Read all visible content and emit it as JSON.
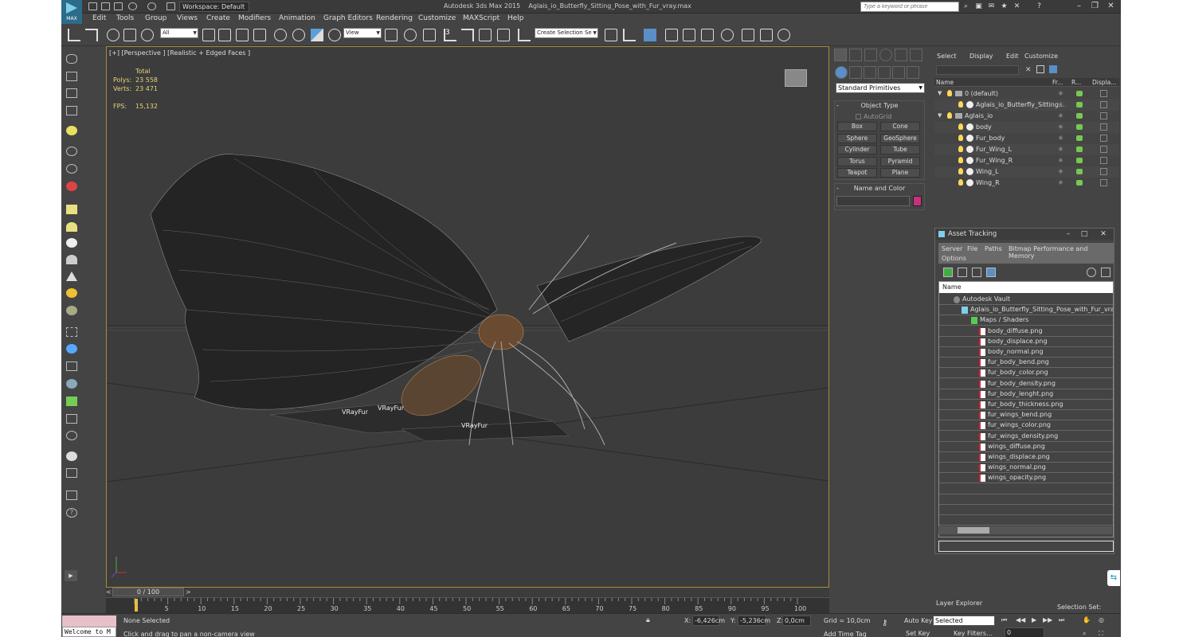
{
  "titlebar": {
    "workspace": "Workspace: Default",
    "app_title": "Autodesk 3ds Max 2015",
    "file_title": "Aglais_io_Butterfly_Sitting_Pose_with_Fur_vray.max",
    "search_placeholder": "Type a keyword or phrase",
    "logo_text": "MAX"
  },
  "menu": [
    "Edit",
    "Tools",
    "Group",
    "Views",
    "Create",
    "Modifiers",
    "Animation",
    "Graph Editors",
    "Rendering",
    "Customize",
    "MAXScript",
    "Help"
  ],
  "toolbar": {
    "filter": "All",
    "refcoord": "View",
    "selection_set": "Create Selection Se",
    "snap_label": "3"
  },
  "viewport": {
    "label": "[+] [Perspective ] [Realistic + Edged Faces ]",
    "stats_total": "Total",
    "polys_label": "Polys:",
    "polys_value": "23 558",
    "verts_label": "Verts:",
    "verts_value": "23 471",
    "fps_label": "FPS:",
    "fps_value": "15,132",
    "fur_labels": [
      "VRayFur",
      "VRayFur",
      "VRayFur"
    ]
  },
  "timeline": {
    "frame": "0 / 100",
    "ticks": [
      "5",
      "10",
      "15",
      "20",
      "25",
      "30",
      "35",
      "40",
      "45",
      "50",
      "55",
      "60",
      "65",
      "70",
      "75",
      "80",
      "85",
      "90",
      "95",
      "100"
    ]
  },
  "status": {
    "maxscript": "Welcome to M",
    "selection": "None Selected",
    "prompt": "Click and drag to pan a non-camera view",
    "x_label": "X:",
    "x_value": "-6,426cm",
    "y_label": "Y:",
    "y_value": "-5,236cm",
    "z_label": "Z:",
    "z_value": "0,0cm",
    "grid": "Grid = 10,0cm",
    "add_time_tag": "Add Time Tag",
    "auto_key": "Auto Key",
    "set_key": "Set Key",
    "key_mode": "Selected",
    "key_filters": "Key Filters...",
    "current_frame": "0",
    "selection_set": "Selection Set:"
  },
  "command_panel": {
    "category": "Standard Primitives",
    "object_type_title": "Object Type",
    "autogrid": "AutoGrid",
    "primitives": [
      "Box",
      "Cone",
      "Sphere",
      "GeoSphere",
      "Cylinder",
      "Tube",
      "Torus",
      "Pyramid",
      "Teapot",
      "Plane"
    ],
    "name_color_title": "Name and Color"
  },
  "scene_explorer": {
    "menu": [
      "Select",
      "Display",
      "Edit",
      "Customize"
    ],
    "columns": [
      "Name",
      "Fr...",
      "R...",
      "Displa..."
    ],
    "rows": [
      {
        "name": "0 (default)",
        "level": 0,
        "kind": "layer",
        "expand": "▼"
      },
      {
        "name": "Aglais_io_Butterfly_Sitting...",
        "level": 1,
        "kind": "obj",
        "expand": ""
      },
      {
        "name": "Aglais_io",
        "level": 0,
        "kind": "layer",
        "expand": "▼"
      },
      {
        "name": "body",
        "level": 1,
        "kind": "obj",
        "expand": ""
      },
      {
        "name": "Fur_body",
        "level": 1,
        "kind": "obj",
        "expand": ""
      },
      {
        "name": "Fur_Wing_L",
        "level": 1,
        "kind": "obj",
        "expand": ""
      },
      {
        "name": "Fur_Wing_R",
        "level": 1,
        "kind": "obj",
        "expand": ""
      },
      {
        "name": "Wing_L",
        "level": 1,
        "kind": "obj",
        "expand": ""
      },
      {
        "name": "Wing_R",
        "level": 1,
        "kind": "obj",
        "expand": ""
      }
    ],
    "layer_explorer": "Layer Explorer"
  },
  "asset_tracking": {
    "title": "Asset Tracking",
    "menu": [
      "Server",
      "File",
      "Paths",
      "Bitmap Performance and Memory",
      "Options"
    ],
    "name_header": "Name",
    "items": [
      {
        "name": "Autodesk Vault",
        "level": 0,
        "kind": "vault"
      },
      {
        "name": "Aglais_io_Butterfly_Sitting_Pose_with_Fur_vray.max",
        "level": 1,
        "kind": "maxf"
      },
      {
        "name": "Maps / Shaders",
        "level": 2,
        "kind": "folder"
      },
      {
        "name": "body_diffuse.png",
        "level": 3,
        "kind": "png"
      },
      {
        "name": "body_displace.png",
        "level": 3,
        "kind": "png"
      },
      {
        "name": "body_normal.png",
        "level": 3,
        "kind": "png"
      },
      {
        "name": "fur_body_bend.png",
        "level": 3,
        "kind": "png"
      },
      {
        "name": "fur_body_color.png",
        "level": 3,
        "kind": "png"
      },
      {
        "name": "fur_body_density.png",
        "level": 3,
        "kind": "png"
      },
      {
        "name": "fur_body_lenght.png",
        "level": 3,
        "kind": "png"
      },
      {
        "name": "fur_body_thickness.png",
        "level": 3,
        "kind": "png"
      },
      {
        "name": "fur_wings_bend.png",
        "level": 3,
        "kind": "png"
      },
      {
        "name": "fur_wings_color.png",
        "level": 3,
        "kind": "png"
      },
      {
        "name": "fur_wings_density.png",
        "level": 3,
        "kind": "png"
      },
      {
        "name": "wings_diffuse.png",
        "level": 3,
        "kind": "png"
      },
      {
        "name": "wings_displace.png",
        "level": 3,
        "kind": "png"
      },
      {
        "name": "wings_normal.png",
        "level": 3,
        "kind": "png"
      },
      {
        "name": "wings_opacity.png",
        "level": 3,
        "kind": "png"
      }
    ]
  },
  "colors": {
    "viewport_border": "#a88b3e",
    "stats_text": "#e8d27a",
    "object_color": "#c8307a",
    "accent": "#5a8fc8"
  }
}
